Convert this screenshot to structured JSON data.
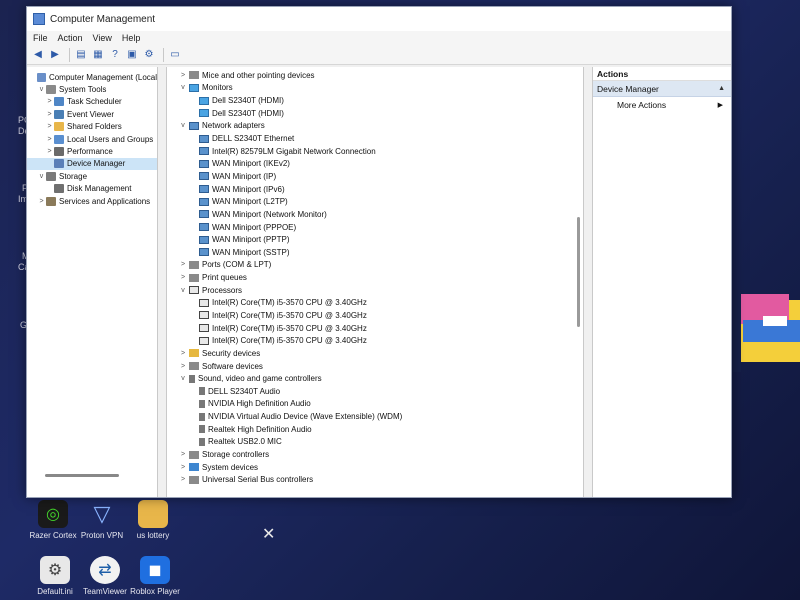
{
  "window": {
    "title": "Computer Management",
    "menu": [
      "File",
      "Action",
      "View",
      "Help"
    ]
  },
  "tree": {
    "items": [
      {
        "label": "Computer Management (Local",
        "level": 0,
        "expander": "",
        "icon": "computer-icon",
        "selected": false
      },
      {
        "label": "System Tools",
        "level": 1,
        "expander": "v",
        "icon": "tools-icon",
        "selected": false
      },
      {
        "label": "Task Scheduler",
        "level": 2,
        "expander": ">",
        "icon": "clock-icon",
        "selected": false
      },
      {
        "label": "Event Viewer",
        "level": 2,
        "expander": ">",
        "icon": "event-viewer-icon",
        "selected": false
      },
      {
        "label": "Shared Folders",
        "level": 2,
        "expander": ">",
        "icon": "folder-icon",
        "selected": false
      },
      {
        "label": "Local Users and Groups",
        "level": 2,
        "expander": ">",
        "icon": "users-icon",
        "selected": false
      },
      {
        "label": "Performance",
        "level": 2,
        "expander": ">",
        "icon": "performance-icon",
        "selected": false
      },
      {
        "label": "Device Manager",
        "level": 2,
        "expander": "",
        "icon": "device-manager-icon",
        "selected": true
      },
      {
        "label": "Storage",
        "level": 1,
        "expander": "v",
        "icon": "storage-icon",
        "selected": false
      },
      {
        "label": "Disk Management",
        "level": 2,
        "expander": "",
        "icon": "disk-icon",
        "selected": false
      },
      {
        "label": "Services and Applications",
        "level": 1,
        "expander": ">",
        "icon": "services-icon",
        "selected": false
      }
    ]
  },
  "devices": {
    "rows": [
      {
        "label": "Mice and other pointing devices",
        "level": 0,
        "expander": ">",
        "icon": "mouse-icon",
        "ic": "ic-gray"
      },
      {
        "label": "Monitors",
        "level": 0,
        "expander": "v",
        "icon": "monitor-icon",
        "ic": "ic-mon"
      },
      {
        "label": "Dell S2340T (HDMI)",
        "level": 1,
        "expander": "",
        "icon": "monitor-icon",
        "ic": "ic-mon"
      },
      {
        "label": "Dell S2340T (HDMI)",
        "level": 1,
        "expander": "",
        "icon": "monitor-icon",
        "ic": "ic-mon"
      },
      {
        "label": "Network adapters",
        "level": 0,
        "expander": "v",
        "icon": "network-adapter-icon",
        "ic": "ic-net"
      },
      {
        "label": "DELL S2340T Ethernet",
        "level": 1,
        "expander": "",
        "icon": "network-adapter-icon",
        "ic": "ic-net"
      },
      {
        "label": "Intel(R) 82579LM Gigabit Network Connection",
        "level": 1,
        "expander": "",
        "icon": "network-adapter-icon",
        "ic": "ic-net"
      },
      {
        "label": "WAN Miniport (IKEv2)",
        "level": 1,
        "expander": "",
        "icon": "network-adapter-icon",
        "ic": "ic-net"
      },
      {
        "label": "WAN Miniport (IP)",
        "level": 1,
        "expander": "",
        "icon": "network-adapter-icon",
        "ic": "ic-net"
      },
      {
        "label": "WAN Miniport (IPv6)",
        "level": 1,
        "expander": "",
        "icon": "network-adapter-icon",
        "ic": "ic-net"
      },
      {
        "label": "WAN Miniport (L2TP)",
        "level": 1,
        "expander": "",
        "icon": "network-adapter-icon",
        "ic": "ic-net"
      },
      {
        "label": "WAN Miniport (Network Monitor)",
        "level": 1,
        "expander": "",
        "icon": "network-adapter-icon",
        "ic": "ic-net"
      },
      {
        "label": "WAN Miniport (PPPOE)",
        "level": 1,
        "expander": "",
        "icon": "network-adapter-icon",
        "ic": "ic-net"
      },
      {
        "label": "WAN Miniport (PPTP)",
        "level": 1,
        "expander": "",
        "icon": "network-adapter-icon",
        "ic": "ic-net"
      },
      {
        "label": "WAN Miniport (SSTP)",
        "level": 1,
        "expander": "",
        "icon": "network-adapter-icon",
        "ic": "ic-net"
      },
      {
        "label": "Ports (COM & LPT)",
        "level": 0,
        "expander": ">",
        "icon": "port-icon",
        "ic": "ic-gray"
      },
      {
        "label": "Print queues",
        "level": 0,
        "expander": ">",
        "icon": "printer-icon",
        "ic": "ic-gray"
      },
      {
        "label": "Processors",
        "level": 0,
        "expander": "v",
        "icon": "processor-icon",
        "ic": "ic-cpu"
      },
      {
        "label": "Intel(R) Core(TM) i5-3570 CPU @ 3.40GHz",
        "level": 1,
        "expander": "",
        "icon": "processor-icon",
        "ic": "ic-cpu"
      },
      {
        "label": "Intel(R) Core(TM) i5-3570 CPU @ 3.40GHz",
        "level": 1,
        "expander": "",
        "icon": "processor-icon",
        "ic": "ic-cpu"
      },
      {
        "label": "Intel(R) Core(TM) i5-3570 CPU @ 3.40GHz",
        "level": 1,
        "expander": "",
        "icon": "processor-icon",
        "ic": "ic-cpu"
      },
      {
        "label": "Intel(R) Core(TM) i5-3570 CPU @ 3.40GHz",
        "level": 1,
        "expander": "",
        "icon": "processor-icon",
        "ic": "ic-cpu"
      },
      {
        "label": "Security devices",
        "level": 0,
        "expander": ">",
        "icon": "security-device-icon",
        "ic": "ic-yellow"
      },
      {
        "label": "Software devices",
        "level": 0,
        "expander": ">",
        "icon": "software-device-icon",
        "ic": "ic-gray"
      },
      {
        "label": "Sound, video and game controllers",
        "level": 0,
        "expander": "v",
        "icon": "speaker-icon",
        "ic": "ic-snd"
      },
      {
        "label": "DELL S2340T Audio",
        "level": 1,
        "expander": "",
        "icon": "speaker-icon",
        "ic": "ic-snd"
      },
      {
        "label": "NVIDIA High Definition Audio",
        "level": 1,
        "expander": "",
        "icon": "speaker-icon",
        "ic": "ic-snd"
      },
      {
        "label": "NVIDIA Virtual Audio Device (Wave Extensible) (WDM)",
        "level": 1,
        "expander": "",
        "icon": "speaker-icon",
        "ic": "ic-snd"
      },
      {
        "label": "Realtek High Definition Audio",
        "level": 1,
        "expander": "",
        "icon": "speaker-icon",
        "ic": "ic-snd"
      },
      {
        "label": "Realtek USB2.0 MIC",
        "level": 1,
        "expander": "",
        "icon": "speaker-icon",
        "ic": "ic-snd"
      },
      {
        "label": "Storage controllers",
        "level": 0,
        "expander": ">",
        "icon": "storage-controller-icon",
        "ic": "ic-gray"
      },
      {
        "label": "System devices",
        "level": 0,
        "expander": ">",
        "icon": "system-device-icon",
        "ic": "ic-blue"
      },
      {
        "label": "Universal Serial Bus controllers",
        "level": 0,
        "expander": ">",
        "icon": "usb-icon",
        "ic": "ic-gray"
      }
    ]
  },
  "actions": {
    "header": "Actions",
    "section": "Device Manager",
    "section_arrow": "▲",
    "items": [
      {
        "label": "More Actions",
        "arrow": "▶"
      }
    ]
  },
  "desktop": {
    "left_labels": [
      "PC",
      "Del",
      "F",
      "Im",
      "M",
      "Ca",
      "Go"
    ],
    "icons": [
      {
        "label": "Razer Cortex",
        "icon": "razer-cortex-icon"
      },
      {
        "label": "Proton VPN",
        "icon": "proton-vpn-icon"
      },
      {
        "label": "us lottery",
        "icon": "folder-icon"
      },
      {
        "label": "Default.ini",
        "icon": "file-icon"
      },
      {
        "label": "TeamViewer",
        "icon": "teamviewer-icon"
      },
      {
        "label": "Roblox Player",
        "icon": "roblox-icon"
      }
    ]
  }
}
